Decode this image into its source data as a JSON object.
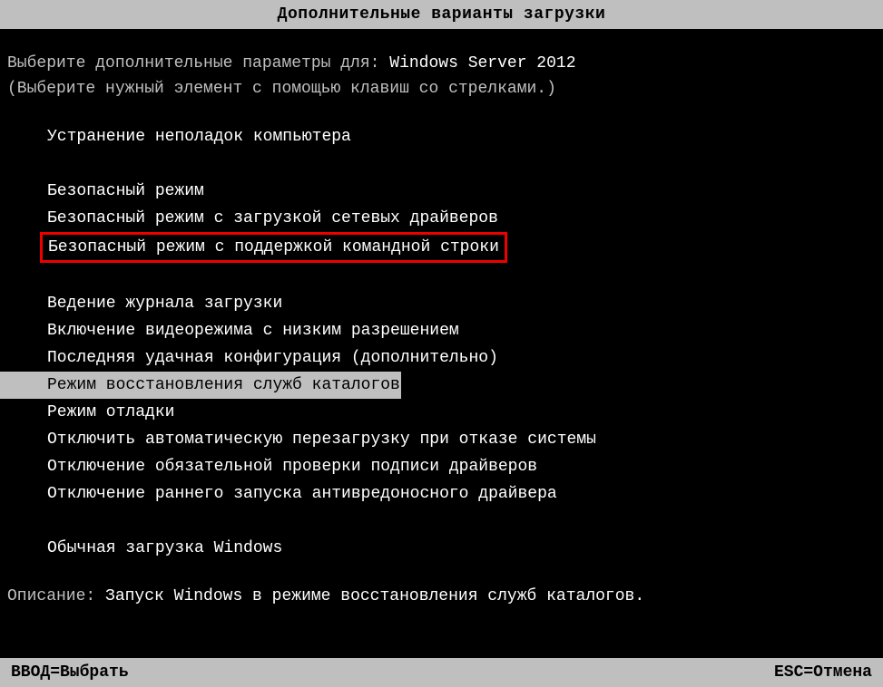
{
  "title": "Дополнительные варианты загрузки",
  "prompt": {
    "prefix": "Выберите дополнительные параметры для: ",
    "target": "Windows Server 2012"
  },
  "instruction": "(Выберите нужный элемент с помощью клавиш со стрелками.)",
  "menu": {
    "group1": [
      "Устранение неполадок компьютера"
    ],
    "group2": [
      "Безопасный режим",
      "Безопасный режим с загрузкой сетевых драйверов",
      "Безопасный режим с поддержкой командной строки"
    ],
    "group3": [
      "Ведение журнала загрузки",
      "Включение видеорежима с низким разрешением",
      "Последняя удачная конфигурация (дополнительно)",
      "Режим восстановления служб каталогов",
      "Режим отладки",
      "Отключить автоматическую перезагрузку при отказе системы",
      "Отключение обязательной проверки подписи драйверов",
      "Отключение раннего запуска антивредоносного драйвера"
    ],
    "group4": [
      "Обычная загрузка Windows"
    ],
    "highlighted_path": "menu.group2.2",
    "selected_path": "menu.group3.3"
  },
  "description": {
    "label": "Описание: ",
    "text": "Запуск Windows в режиме восстановления служб каталогов."
  },
  "footer": {
    "enter": "ВВОД=Выбрать",
    "esc": "ESC=Отмена"
  }
}
